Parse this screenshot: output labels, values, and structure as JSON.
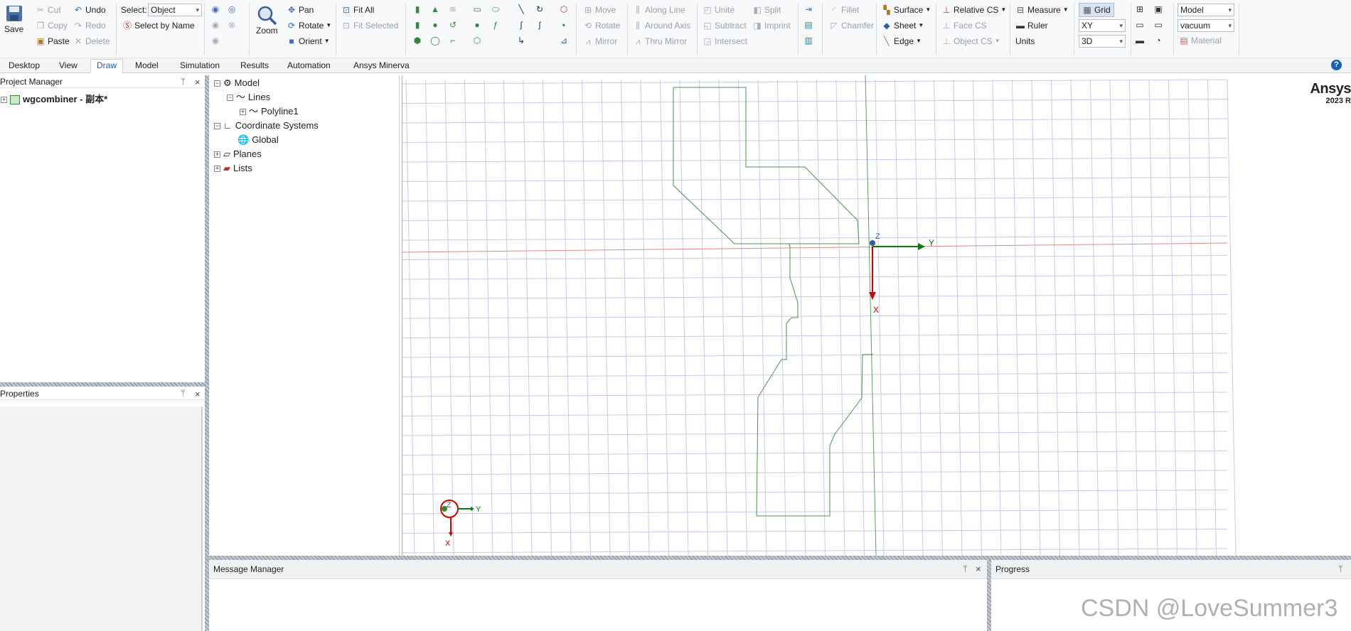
{
  "ribbon": {
    "save": "Save",
    "cut": "Cut",
    "copy": "Copy",
    "paste": "Paste",
    "undo": "Undo",
    "redo": "Redo",
    "delete": "Delete",
    "select_label": "Select:",
    "select_value": "Object",
    "select_by_name": "Select by Name",
    "zoom": "Zoom",
    "pan": "Pan",
    "rotate": "Rotate",
    "orient": "Orient",
    "fit_all": "Fit All",
    "fit_selected": "Fit Selected",
    "move": "Move",
    "rotate2": "Rotate",
    "mirror": "Mirror",
    "along_line": "Along Line",
    "around_axis": "Around Axis",
    "thru_mirror": "Thru Mirror",
    "unite": "Unite",
    "subtract": "Subtract",
    "intersect": "Intersect",
    "split": "Split",
    "imprint": "Imprint",
    "fillet": "Fillet",
    "chamfer": "Chamfer",
    "surface": "Surface",
    "sheet": "Sheet",
    "edge": "Edge",
    "relative_cs": "Relative CS",
    "face_cs": "Face CS",
    "object_cs": "Object CS",
    "measure": "Measure",
    "ruler": "Ruler",
    "units": "Units",
    "grid": "Grid",
    "plane_value": "XY",
    "dim_value": "3D",
    "model_value": "Model",
    "material_value": "vacuum",
    "material": "Material"
  },
  "tabs": [
    "Desktop",
    "View",
    "Draw",
    "Model",
    "Simulation",
    "Results",
    "Automation",
    "Ansys Minerva"
  ],
  "active_tab": "Draw",
  "project_manager": {
    "title": "Project Manager",
    "project": "wgcombiner - 副本*"
  },
  "properties": {
    "title": "Properties"
  },
  "model_tree": {
    "model": "Model",
    "lines": "Lines",
    "polyline": "Polyline1",
    "coord_systems": "Coordinate Systems",
    "global": "Global",
    "planes": "Planes",
    "lists": "Lists"
  },
  "viewport": {
    "brand": "Ansys",
    "version": "2023 R",
    "axis_x": "X",
    "axis_y": "Y",
    "axis_z": "Z"
  },
  "message_manager": {
    "title": "Message Manager"
  },
  "progress": {
    "title": "Progress"
  },
  "watermark": "CSDN @LoveSummer3",
  "colors": {
    "accent": "#1a5fb4",
    "grid_line": "#c9cbe6",
    "x_axis": "#d40000",
    "y_axis": "#0a7a0a",
    "polyline": "#4f8f4f"
  }
}
